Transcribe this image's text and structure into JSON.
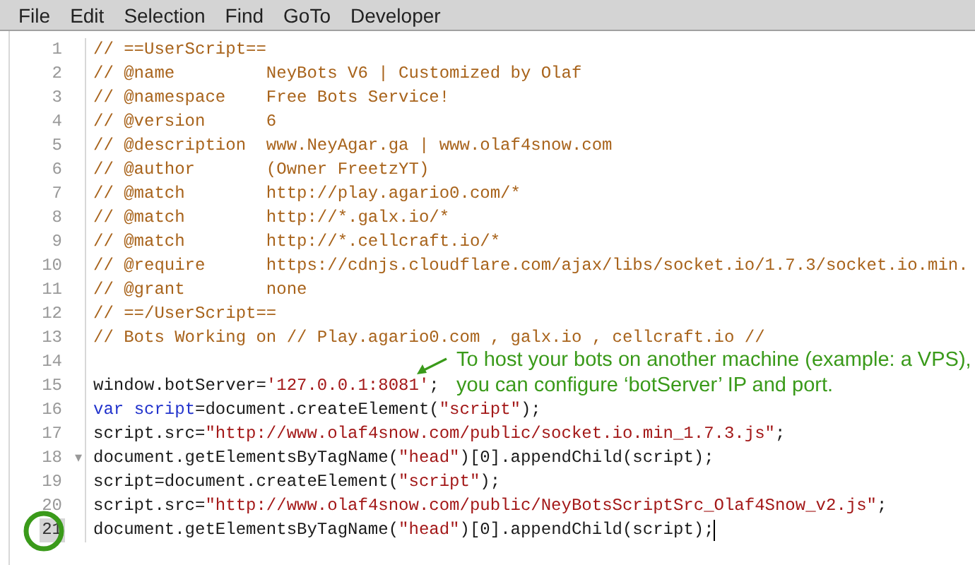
{
  "menu": [
    {
      "label": "File"
    },
    {
      "label": "Edit"
    },
    {
      "label": "Selection"
    },
    {
      "label": "Find"
    },
    {
      "label": "GoTo"
    },
    {
      "label": "Developer"
    }
  ],
  "lines": [
    {
      "number": "1",
      "tokens": [
        {
          "kind": "comment",
          "text": "// ==UserScript=="
        }
      ]
    },
    {
      "number": "2",
      "tokens": [
        {
          "kind": "comment",
          "text": "// @name         NeyBots V6 | Customized by Olaf"
        }
      ]
    },
    {
      "number": "3",
      "tokens": [
        {
          "kind": "comment",
          "text": "// @namespace    Free Bots Service!"
        }
      ]
    },
    {
      "number": "4",
      "tokens": [
        {
          "kind": "comment",
          "text": "// @version      6"
        }
      ]
    },
    {
      "number": "5",
      "tokens": [
        {
          "kind": "comment",
          "text": "// @description  www.NeyAgar.ga | www.olaf4snow.com"
        }
      ]
    },
    {
      "number": "6",
      "tokens": [
        {
          "kind": "comment",
          "text": "// @author       (Owner FreetzYT)"
        }
      ]
    },
    {
      "number": "7",
      "tokens": [
        {
          "kind": "comment",
          "text": "// @match        http://play.agario0.com/*"
        }
      ]
    },
    {
      "number": "8",
      "tokens": [
        {
          "kind": "comment",
          "text": "// @match        http://*.galx.io/*"
        }
      ]
    },
    {
      "number": "9",
      "tokens": [
        {
          "kind": "comment",
          "text": "// @match        http://*.cellcraft.io/*"
        }
      ]
    },
    {
      "number": "10",
      "tokens": [
        {
          "kind": "comment",
          "text": "// @require      https://cdnjs.cloudflare.com/ajax/libs/socket.io/1.7.3/socket.io.min."
        }
      ]
    },
    {
      "number": "11",
      "tokens": [
        {
          "kind": "comment",
          "text": "// @grant        none"
        }
      ]
    },
    {
      "number": "12",
      "tokens": [
        {
          "kind": "comment",
          "text": "// ==/UserScript=="
        }
      ]
    },
    {
      "number": "13",
      "tokens": [
        {
          "kind": "comment",
          "text": "// Bots Working on // Play.agario0.com , galx.io , cellcraft.io //"
        }
      ]
    },
    {
      "number": "14"
    },
    {
      "number": "15",
      "tokens": [
        {
          "kind": "plain",
          "text": "window.botServer="
        },
        {
          "kind": "string",
          "text": "'127.0.0.1:8081'"
        },
        {
          "kind": "plain",
          "text": ";"
        }
      ]
    },
    {
      "number": "16",
      "tokens": [
        {
          "kind": "keyword",
          "text": "var "
        },
        {
          "kind": "def",
          "text": "script"
        },
        {
          "kind": "plain",
          "text": "=document.createElement("
        },
        {
          "kind": "string",
          "text": "\"script\""
        },
        {
          "kind": "plain",
          "text": ");"
        }
      ]
    },
    {
      "number": "17",
      "tokens": [
        {
          "kind": "plain",
          "text": "script.src="
        },
        {
          "kind": "string",
          "text": "\"http://www.olaf4snow.com/public/socket.io.min_1.7.3.js\""
        },
        {
          "kind": "plain",
          "text": ";"
        }
      ]
    },
    {
      "number": "18",
      "fold": "▾",
      "tokens": [
        {
          "kind": "plain",
          "text": "document.getElementsByTagName("
        },
        {
          "kind": "string",
          "text": "\"head\""
        },
        {
          "kind": "plain",
          "text": ")[0].appendChild(script);"
        }
      ]
    },
    {
      "number": "19",
      "tokens": [
        {
          "kind": "plain",
          "text": "script=document.createElement("
        },
        {
          "kind": "string",
          "text": "\"script\""
        },
        {
          "kind": "plain",
          "text": ");"
        }
      ]
    },
    {
      "number": "20",
      "tokens": [
        {
          "kind": "plain",
          "text": "script.src="
        },
        {
          "kind": "string",
          "text": "\"http://www.olaf4snow.com/public/NeyBotsScriptSrc_Olaf4Snow_v2.js\""
        },
        {
          "kind": "plain",
          "text": ";"
        }
      ]
    },
    {
      "number": "21",
      "active": true,
      "circled": true,
      "cursor": true,
      "tokens": [
        {
          "kind": "plain",
          "text": "document.getElementsByTagName("
        },
        {
          "kind": "string",
          "text": "\"head\""
        },
        {
          "kind": "plain",
          "text": ")[0].appendChild(script);"
        }
      ]
    }
  ],
  "note": {
    "lines": [
      "To host your bots on another machine (example: a VPS),",
      "you can configure ‘botServer’ IP and port."
    ]
  }
}
